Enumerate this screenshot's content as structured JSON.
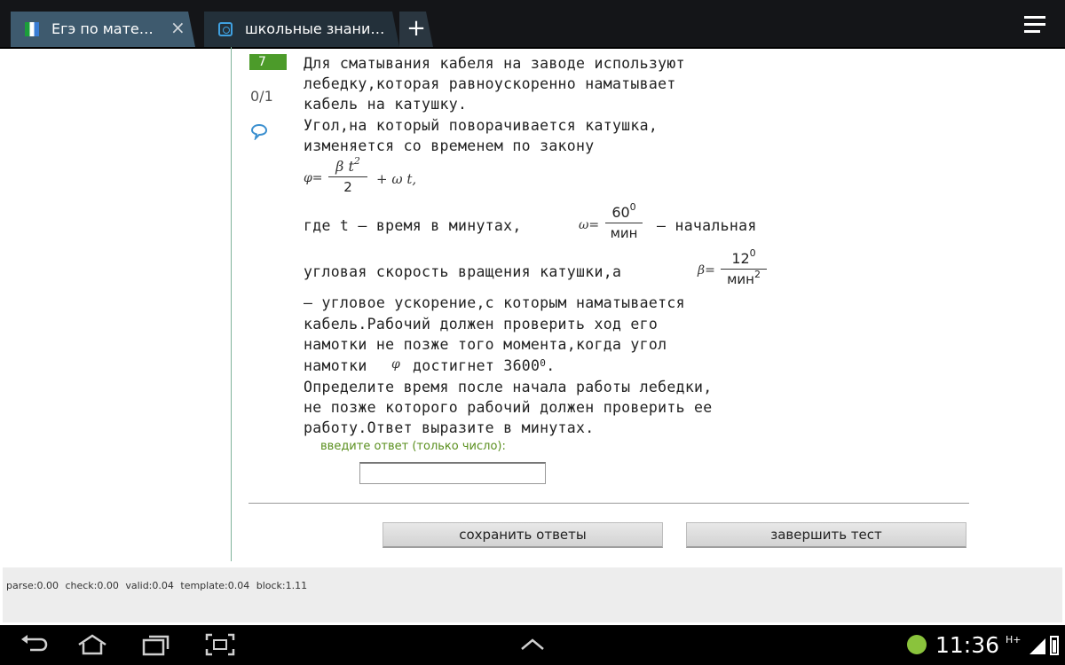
{
  "tabs": [
    {
      "label": "Егэ по мате…",
      "close": "×"
    },
    {
      "label": "школьные знани…"
    }
  ],
  "new_tab": "+",
  "question": {
    "number": "7",
    "score": "0/1",
    "lines_top": [
      "Для сматывания кабеля на заводе используют",
      "лебедку,которая равноускоренно наматывает",
      "кабель на катушку.",
      "Угол,на который поворачивается катушка,",
      "изменяется со временем по закону"
    ],
    "formula": {
      "phi": "φ=",
      "num": "β t",
      "num_sup": "2",
      "den": "2",
      "tail": "+ ω t,"
    },
    "line_omega": {
      "pre": "где t — время в минутах,",
      "sym": "ω=",
      "num": "60",
      "num_sup": "0",
      "den": "мин",
      "post": "— начальная"
    },
    "line_beta": {
      "pre": "угловая скорость вращения катушки,а",
      "sym": "β=",
      "num": "12",
      "num_sup": "0",
      "den": "мин",
      "den_sup": "2"
    },
    "lines_bottom": [
      "— угловое ускорение,с которым наматывается",
      "кабель.Рабочий должен проверить ход его",
      "намотки не позже того момента,когда угол"
    ],
    "line_phi": {
      "pre": "намотки",
      "sym": "φ",
      "post": "достигнет 3600",
      "sup": "0",
      "end": "."
    },
    "lines_final": [
      "Определите время после начала работы лебедки,",
      "не позже которого рабочий должен проверить ее",
      "работу.Ответ выразите в минутах."
    ],
    "hint": "введите ответ (только число):",
    "answer_value": ""
  },
  "buttons": {
    "save": "сохранить ответы",
    "finish": "завершить тест"
  },
  "stats": "parse:0.00  check:0.00  valid:0.04  template:0.04  block:1.11",
  "status": {
    "time": "11:36",
    "network": "H+"
  },
  "colors": {
    "accent": "#4c9b2a",
    "hint": "#5a8f1e",
    "tab_active": "#3e5a6e"
  }
}
